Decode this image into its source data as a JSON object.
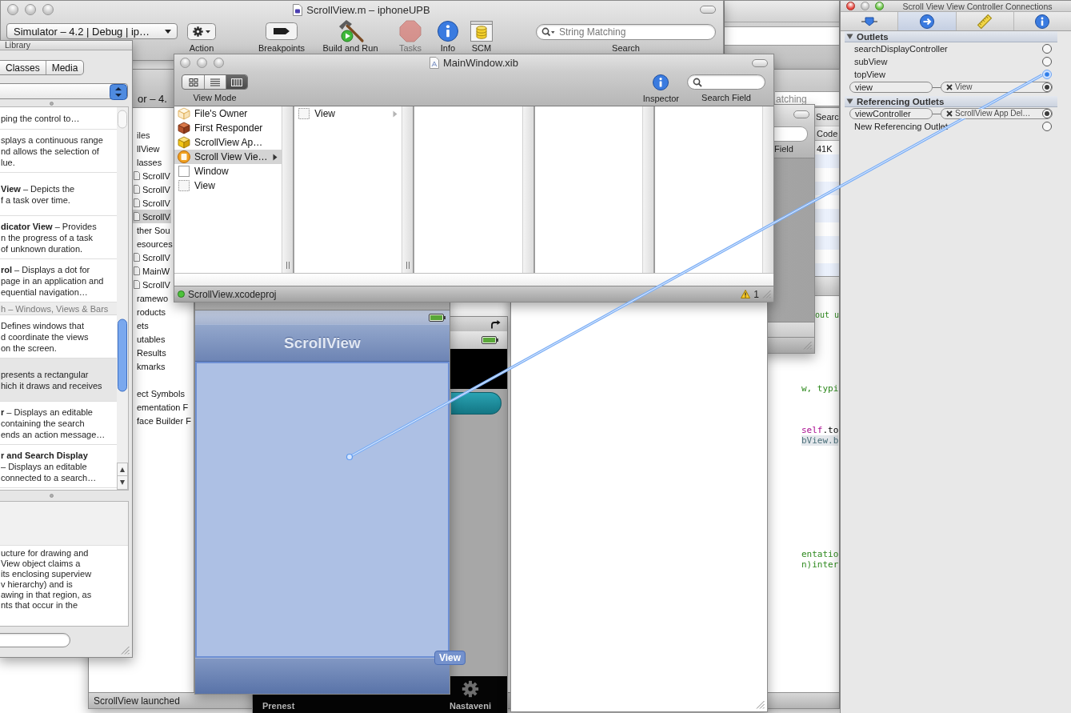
{
  "project_window": {
    "title": "ScrollView.m – iphoneUPB",
    "scheme": "Simulator – 4.2 | Debug | ip…",
    "tools": [
      {
        "kind": "action",
        "label": "Action",
        "disabled": false
      },
      {
        "kind": "breakpoints",
        "label": "Breakpoints",
        "disabled": false
      },
      {
        "kind": "build",
        "label": "Build and Run",
        "disabled": false
      },
      {
        "kind": "tasks",
        "label": "Tasks",
        "disabled": true
      },
      {
        "kind": "info",
        "label": "Info",
        "disabled": false
      },
      {
        "kind": "scm",
        "label": "SCM",
        "disabled": false
      }
    ],
    "search": {
      "placeholder": "String Matching",
      "label": "Search"
    }
  },
  "inspector": {
    "title": "Scroll View View Controller Connections",
    "tabs": [
      {
        "kind": "attributes",
        "selected": false
      },
      {
        "kind": "connections",
        "selected": true
      },
      {
        "kind": "size",
        "selected": false
      },
      {
        "kind": "identity",
        "selected": false
      }
    ],
    "sections": [
      {
        "title": "Outlets",
        "expanded": true,
        "rows": [
          {
            "name": "searchDisplayController",
            "connected": false,
            "dragging": false
          },
          {
            "name": "subView",
            "connected": false,
            "dragging": false
          },
          {
            "name": "topView",
            "connected": false,
            "dragging": true
          },
          {
            "name": "view",
            "connected": true,
            "dragging": false,
            "target": "View"
          }
        ]
      },
      {
        "title": "Referencing Outlets",
        "expanded": true,
        "rows": [
          {
            "name": "viewController",
            "connected": true,
            "dragging": false,
            "target": "ScrollView App Del…"
          },
          {
            "name": "New Referencing Outlet",
            "connected": false,
            "dragging": false
          }
        ]
      }
    ]
  },
  "library": {
    "title": "Library",
    "segments": [
      {
        "label": "Classes",
        "selected": false
      },
      {
        "label": "Media",
        "selected": false
      }
    ],
    "entries": [
      {
        "kind": "item",
        "selected": false,
        "lines": [
          "ping the control to…"
        ]
      },
      {
        "kind": "item",
        "selected": false,
        "lines": [
          "splays a continuous range",
          "nd allows the selection of",
          "lue."
        ]
      },
      {
        "kind": "item",
        "selected": false,
        "lines": [
          "**View** – Depicts the",
          "f a task over time."
        ]
      },
      {
        "kind": "item",
        "selected": false,
        "lines": [
          "**dicator View** – Provides",
          "n the progress of a task",
          "of unknown duration."
        ]
      },
      {
        "kind": "item",
        "selected": false,
        "lines": [
          "**rol** – Displays a dot for",
          "page in an application and",
          "equential navigation…"
        ]
      },
      {
        "kind": "section",
        "selected": false,
        "label": "h – Windows, Views & Bars"
      },
      {
        "kind": "item",
        "selected": false,
        "lines": [
          "Defines windows that",
          "d coordinate the views",
          "on the screen."
        ]
      },
      {
        "kind": "item",
        "selected": true,
        "lines": [
          "presents a rectangular",
          "hich it draws and receives"
        ]
      },
      {
        "kind": "item",
        "selected": false,
        "lines": [
          "**r** – Displays an editable",
          "containing the search",
          "ends an action message…"
        ]
      },
      {
        "kind": "item",
        "selected": false,
        "heading": "r and Search Display",
        "lines": [
          "– Displays an editable",
          "connected to a search…"
        ]
      }
    ],
    "description": [
      "ucture for drawing and",
      "View object claims a",
      "its enclosing superview",
      "v hierarchy) and is",
      "awing in that region, as",
      "nts that occur in the"
    ]
  },
  "editor_window": {
    "scheme_fragment": "or – 4.",
    "search": {
      "placeholder": "atching"
    },
    "groups_header": "iles",
    "groups": [
      {
        "label": "llView",
        "kind": "group",
        "selected": false
      },
      {
        "label": "lasses",
        "kind": "group",
        "selected": false
      },
      {
        "label": "ScrollV",
        "kind": "file",
        "selected": false
      },
      {
        "label": "ScrollV",
        "kind": "file",
        "selected": false
      },
      {
        "label": "ScrollV",
        "kind": "file",
        "selected": false
      },
      {
        "label": "ScrollV",
        "kind": "file",
        "selected": true
      },
      {
        "label": "ther Sou",
        "kind": "group",
        "selected": false
      },
      {
        "label": "esources",
        "kind": "group",
        "selected": false
      },
      {
        "label": "ScrollV",
        "kind": "file",
        "selected": false
      },
      {
        "label": "MainW",
        "kind": "file",
        "selected": false
      },
      {
        "label": "ScrollV",
        "kind": "file",
        "selected": false
      },
      {
        "label": "ramewo",
        "kind": "group",
        "selected": false
      },
      {
        "label": "roducts",
        "kind": "group",
        "selected": false
      },
      {
        "label": "ets",
        "kind": "group",
        "selected": false
      },
      {
        "label": "utables",
        "kind": "group",
        "selected": false
      },
      {
        "label": "Results",
        "kind": "group",
        "selected": false
      },
      {
        "label": "kmarks",
        "kind": "group",
        "selected": false
      }
    ],
    "smart_groups": [
      {
        "label": "ect Symbols",
        "kind": "group",
        "selected": false
      },
      {
        "label": "ementation F",
        "kind": "group",
        "selected": false
      },
      {
        "label": "face Builder F",
        "kind": "group",
        "selected": false
      }
    ],
    "detail": {
      "label": "Searc",
      "column": "Code",
      "size": "41K"
    },
    "code_lines": [
      {
        "highlighted": false,
        "tokens": [
          {
            "kind": "comment",
            "text": "out u"
          }
        ]
      },
      {
        "highlighted": false,
        "tokens": [
          {
            "kind": "comment",
            "text": "w, typi"
          }
        ]
      },
      {
        "highlighted": false,
        "tokens": [
          {
            "kind": "keyword",
            "text": "self"
          },
          {
            "kind": "plain",
            "text": ".to"
          }
        ]
      },
      {
        "highlighted": true,
        "tokens": [
          {
            "kind": "ident",
            "text": "bView.b"
          }
        ]
      },
      {
        "highlighted": false,
        "tokens": [
          {
            "kind": "comment",
            "text": "entatio"
          }
        ]
      },
      {
        "highlighted": false,
        "tokens": [
          {
            "kind": "comment",
            "text": "n)inter"
          }
        ]
      }
    ],
    "status": "ScrollView launched"
  },
  "other_window": {
    "label_fragment": "Field"
  },
  "xib_window": {
    "title": "MainWindow.xib",
    "view_modes": [
      {
        "kind": "icons",
        "selected": false
      },
      {
        "kind": "list",
        "selected": false
      },
      {
        "kind": "columns",
        "selected": true
      }
    ],
    "view_mode_label": "View Mode",
    "inspector_label": "Inspector",
    "search_label": "Search Field",
    "columns": [
      {
        "items": [
          {
            "label": "File's Owner",
            "kind": "owner",
            "selected": false,
            "has_children": false
          },
          {
            "label": "First Responder",
            "kind": "responder",
            "selected": false,
            "has_children": false
          },
          {
            "label": "ScrollView Ap…",
            "kind": "object",
            "selected": false,
            "has_children": false
          },
          {
            "label": "Scroll View Vie…",
            "kind": "controller",
            "selected": true,
            "has_children": true
          },
          {
            "label": "Window",
            "kind": "window",
            "selected": false,
            "has_children": false
          },
          {
            "label": "View",
            "kind": "view",
            "selected": false,
            "has_children": false
          }
        ]
      },
      {
        "items": [
          {
            "label": "View",
            "kind": "view",
            "selected": false,
            "has_children": true
          }
        ]
      }
    ],
    "project": "ScrollView.xcodeproj",
    "warnings": "1"
  },
  "ib_view_window": {
    "nav_title": "ScrollView",
    "badge": "View",
    "view_selected": true
  },
  "simulator": {
    "tabs": [
      {
        "label": "Prenest",
        "kind": "plain"
      },
      {
        "label": "Nastaveni",
        "kind": "settings"
      }
    ]
  }
}
